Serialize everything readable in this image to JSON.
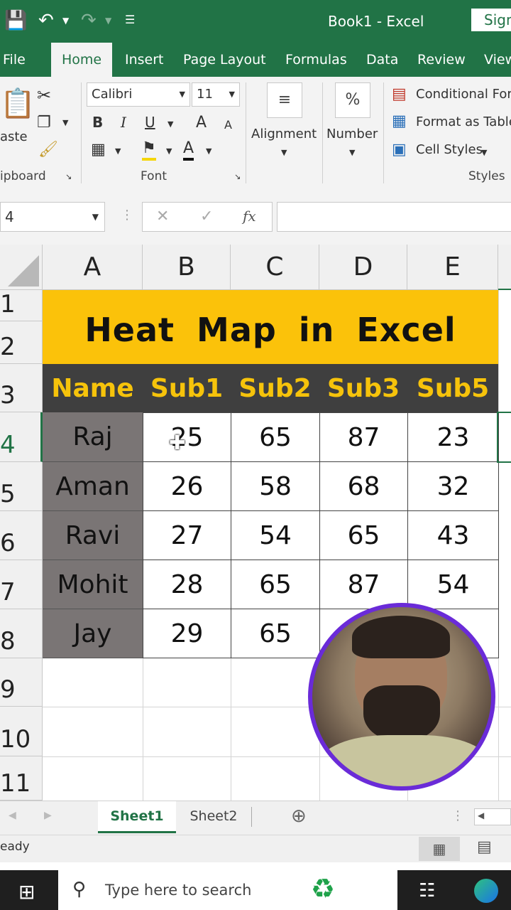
{
  "window": {
    "title": "Book1  -  Excel",
    "sign_in": "Sign"
  },
  "tabs": [
    "File",
    "Home",
    "Insert",
    "Page Layout",
    "Formulas",
    "Data",
    "Review",
    "View"
  ],
  "ribbon": {
    "clipboard": {
      "paste": "aste",
      "label": "ipboard"
    },
    "font": {
      "name": "Calibri",
      "size": "11",
      "bold": "B",
      "italic": "I",
      "underline": "U",
      "grow": "A",
      "shrink": "A",
      "color": "A",
      "label": "Font"
    },
    "alignment": {
      "label": "Alignment"
    },
    "number": {
      "label": "Number",
      "symbol": "%"
    },
    "styles": {
      "conditional": "Conditional For",
      "table": "Format as Table",
      "cell": "Cell Styles",
      "label": "Styles"
    }
  },
  "formula_bar": {
    "name_box": "4",
    "cancel": "✕",
    "enter": "✓",
    "fx": "fx",
    "content": ""
  },
  "columns": [
    "A",
    "B",
    "C",
    "D",
    "E"
  ],
  "rows": [
    "1",
    "2",
    "3",
    "4",
    "5",
    "6",
    "7",
    "8",
    "9",
    "10",
    "11"
  ],
  "sheet": {
    "title": "Heat Map in Excel",
    "headers": [
      "Name",
      "Sub1",
      "Sub2",
      "Sub3",
      "Sub5"
    ],
    "data": [
      [
        "Raj",
        "25",
        "65",
        "87",
        "23"
      ],
      [
        "Aman",
        "26",
        "58",
        "68",
        "32"
      ],
      [
        "Ravi",
        "27",
        "54",
        "65",
        "43"
      ],
      [
        "Mohit",
        "28",
        "65",
        "87",
        "54"
      ],
      [
        "Jay",
        "29",
        "65",
        "",
        ""
      ]
    ]
  },
  "sheet_tabs": [
    "Sheet1",
    "Sheet2"
  ],
  "status": {
    "text": "eady"
  },
  "taskbar": {
    "search_placeholder": "Type here to search"
  },
  "colors": {
    "excel_green": "#217346",
    "banner": "#fbc20a",
    "header_bg": "#3f3f3f",
    "header_text": "#f6c30b",
    "name_bg": "#7a7575"
  }
}
